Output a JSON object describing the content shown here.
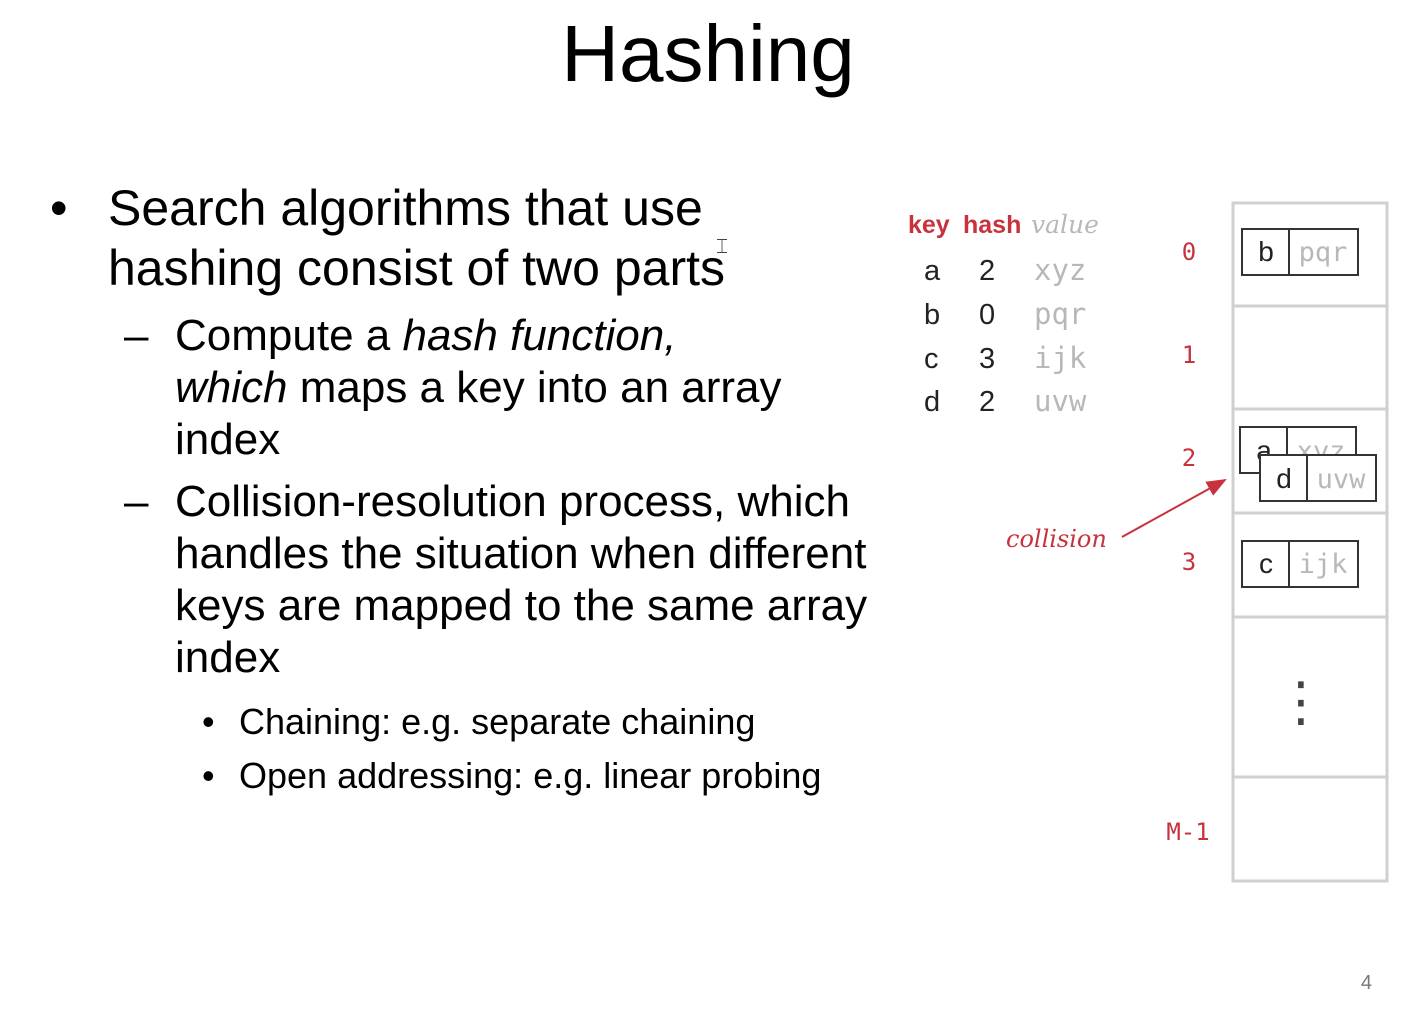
{
  "slide": {
    "title": "Hashing",
    "page_number": "4",
    "bullet_main": "Search algorithms that use hashing consist of two parts",
    "sub1_part1": "Compute a ",
    "sub1_italic1": "hash function,",
    "sub1_italic2": "which",
    "sub1_part2": " maps a key into an array index",
    "sub2": "Collision-resolution process, which handles the situation when different keys are mapped to the same array index",
    "subsub1": "Chaining: e.g. separate chaining",
    "subsub2": "Open addressing: e.g. linear probing",
    "bullet_glyph": "•",
    "dash_glyph": "–"
  },
  "diagram": {
    "headers": {
      "key": "key",
      "hash": "hash",
      "value": "value"
    },
    "rows": [
      {
        "key": "a",
        "hash": "2",
        "value": "xyz"
      },
      {
        "key": "b",
        "hash": "0",
        "value": "pqr"
      },
      {
        "key": "c",
        "hash": "3",
        "value": "ijk"
      },
      {
        "key": "d",
        "hash": "2",
        "value": "uvw"
      }
    ],
    "indices": [
      "0",
      "1",
      "2",
      "3",
      "M-1"
    ],
    "collision_label": "collision",
    "ellipsis": "⋮",
    "colors": {
      "accent": "#c8323c",
      "faded": "#b8b8b8",
      "border": "#d0d0d0",
      "box": "#333333"
    }
  }
}
